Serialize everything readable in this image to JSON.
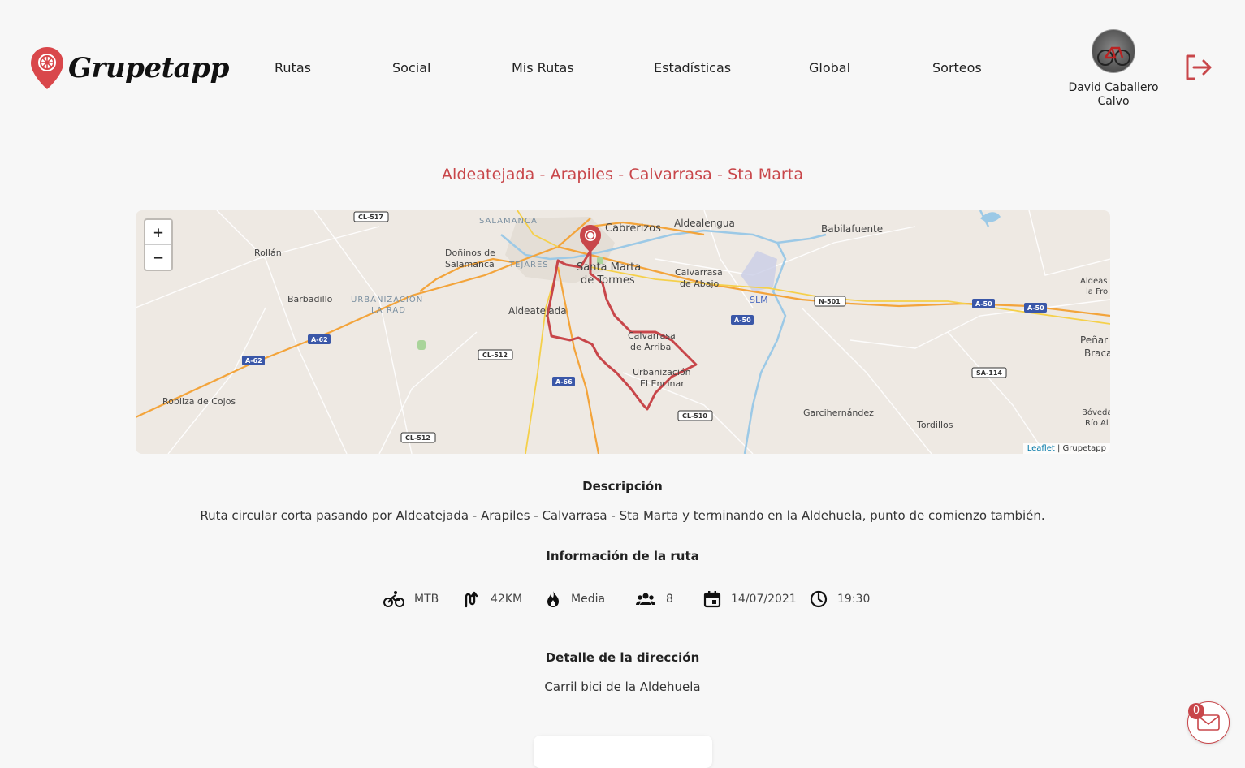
{
  "header": {
    "brand": "Grupetapp",
    "nav": [
      {
        "label": "Rutas"
      },
      {
        "label": "Social"
      },
      {
        "label": "Mis Rutas"
      },
      {
        "label": "Estadísticas"
      },
      {
        "label": "Global"
      },
      {
        "label": "Sorteos"
      }
    ],
    "user": {
      "name_line1": "David Caballero",
      "name_line2": "Calvo"
    },
    "logout_icon": "logout-icon"
  },
  "route": {
    "title": "Aldeatejada - Arapiles - Calvarrasa - Sta Marta"
  },
  "map": {
    "zoom_in": "+",
    "zoom_out": "−",
    "attribution_leaflet": "Leaflet",
    "attribution_separator": " | ",
    "attribution_owner": "Grupetapp",
    "route_color": "#c8464a",
    "places": [
      "SALAMANCA",
      "Cabrerizos",
      "Aldealengua",
      "Babilafuente",
      "Rollán",
      "Doñinos de",
      "Salamanca",
      "TEJARES",
      "Santa Marta",
      "de Tormes",
      "Calvarrasa",
      "de Abajo",
      "SLM",
      "Aldeas",
      "la Fro",
      "Barbadillo",
      "URBANIZACIÓN",
      "LA RAD",
      "Aldeatejada",
      "Calvarrasa",
      "de Arriba",
      "Urbanización",
      "El Encinar",
      "Peñar",
      "Braca",
      "Robliza de Cojos",
      "Garcihernández",
      "Tordillos",
      "Bóveda",
      "Río Al"
    ],
    "roads": [
      "CL-517",
      "A-62",
      "A-62",
      "CL-512",
      "A-66",
      "CL-512",
      "N-501",
      "A-50",
      "A-50",
      "A-50",
      "SA-114",
      "CL-510"
    ]
  },
  "description": {
    "heading": "Descripción",
    "text": "Ruta circular corta pasando por Aldeatejada - Arapiles - Calvarrasa - Sta Marta y terminando en la Aldehuela, punto de comienzo también."
  },
  "info": {
    "heading": "Información de la ruta",
    "items": [
      {
        "icon": "bike-icon",
        "value": "MTB"
      },
      {
        "icon": "route-icon",
        "value": "42KM"
      },
      {
        "icon": "fire-icon",
        "value": "Media"
      },
      {
        "icon": "group-icon",
        "value": "8"
      },
      {
        "icon": "calendar-icon",
        "value": "14/07/2021"
      },
      {
        "icon": "clock-icon",
        "value": "19:30"
      }
    ]
  },
  "address": {
    "heading": "Detalle de la dirección",
    "text": "Carril bici de la Aldehuela"
  },
  "messages": {
    "count": "0"
  },
  "colors": {
    "accent": "#c8464a",
    "background": "#f7f7f7"
  }
}
